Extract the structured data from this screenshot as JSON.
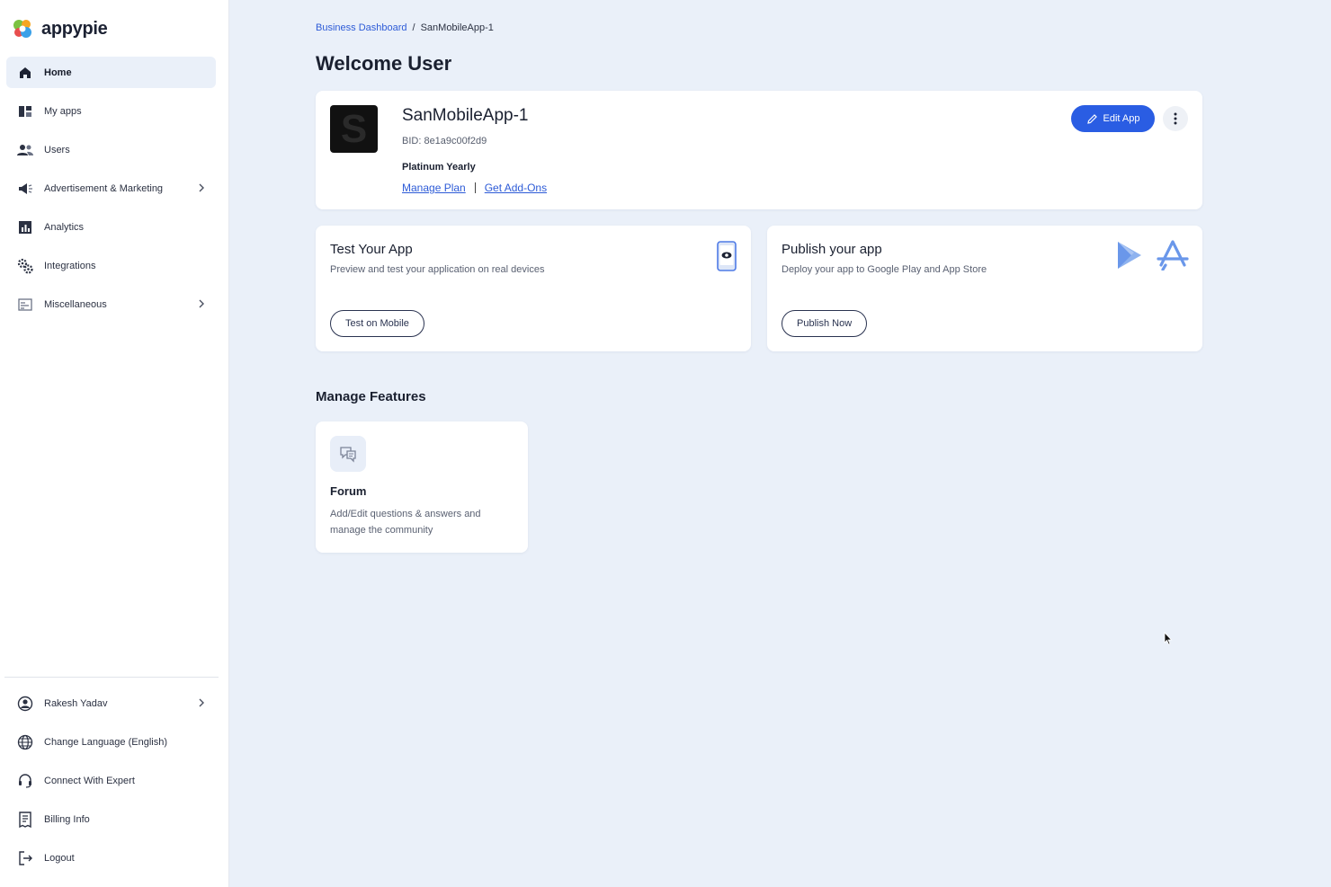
{
  "brand": {
    "name": "appypie"
  },
  "sidebar": {
    "items": [
      {
        "label": "Home",
        "icon": "home-icon",
        "active": true
      },
      {
        "label": "My apps",
        "icon": "apps-icon"
      },
      {
        "label": "Users",
        "icon": "users-icon"
      },
      {
        "label": "Advertisement & Marketing",
        "icon": "megaphone-icon",
        "expandable": true
      },
      {
        "label": "Analytics",
        "icon": "analytics-icon"
      },
      {
        "label": "Integrations",
        "icon": "integrations-icon"
      },
      {
        "label": "Miscellaneous",
        "icon": "miscellaneous-icon",
        "expandable": true
      }
    ],
    "bottom": [
      {
        "label": "Rakesh Yadav",
        "icon": "user-circle-icon",
        "expandable": true
      },
      {
        "label": "Change Language (English)",
        "icon": "globe-icon"
      },
      {
        "label": "Connect With Expert",
        "icon": "headset-icon"
      },
      {
        "label": "Billing Info",
        "icon": "billing-icon"
      },
      {
        "label": "Logout",
        "icon": "logout-icon"
      }
    ]
  },
  "breadcrumb": {
    "root": "Business Dashboard",
    "separator": "/",
    "current": "SanMobileApp-1"
  },
  "welcome": "Welcome User",
  "app": {
    "icon_letter": "S",
    "name": "SanMobileApp-1",
    "bid": "BID: 8e1a9c00f2d9",
    "plan": "Platinum Yearly",
    "manage_plan": "Manage Plan",
    "get_addons": "Get Add-Ons",
    "edit_label": "Edit App"
  },
  "test_card": {
    "title": "Test Your App",
    "desc": "Preview and test your application on real devices",
    "button": "Test on Mobile"
  },
  "publish_card": {
    "title": "Publish your app",
    "desc": "Deploy your app to Google Play and App Store",
    "button": "Publish Now"
  },
  "features": {
    "title": "Manage Features",
    "items": [
      {
        "title": "Forum",
        "desc": "Add/Edit questions & answers and manage the community"
      }
    ]
  },
  "colors": {
    "accent": "#2a5de3",
    "background": "#eaf0f9",
    "link": "#2d5bd7"
  }
}
